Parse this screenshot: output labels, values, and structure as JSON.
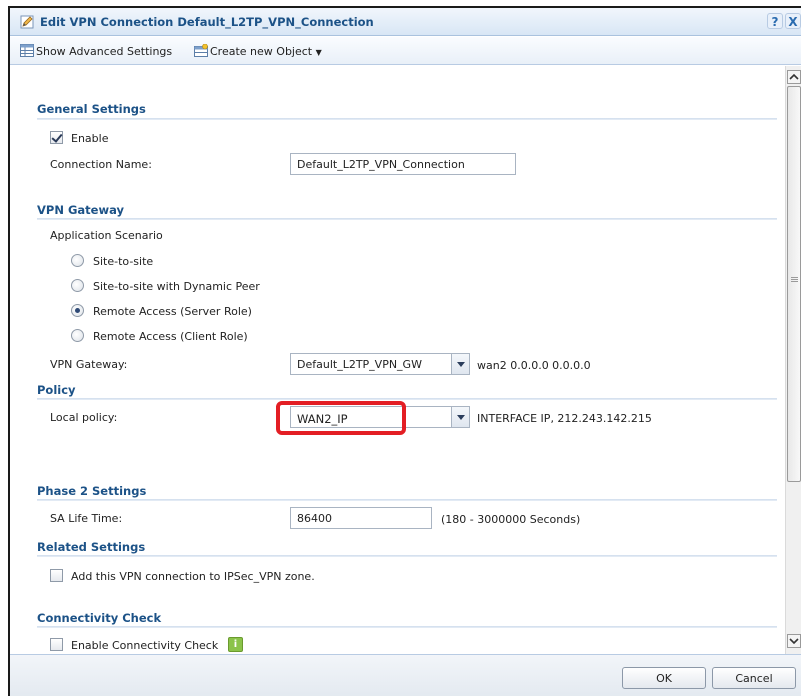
{
  "window": {
    "title": "Edit VPN Connection Default_L2TP_VPN_Connection",
    "help_label": "?",
    "close_label": "X"
  },
  "toolbar": {
    "advanced_label": "Show Advanced Settings",
    "create_label": "Create new Object"
  },
  "general": {
    "title": "General Settings",
    "enable_label": "Enable",
    "enable_checked": true,
    "connection_name_label": "Connection Name:",
    "connection_name_value": "Default_L2TP_VPN_Connection"
  },
  "vpn_gateway": {
    "title": "VPN Gateway",
    "scenario_label": "Application Scenario",
    "scenarios": [
      {
        "label": "Site-to-site",
        "selected": false
      },
      {
        "label": "Site-to-site with Dynamic Peer",
        "selected": false
      },
      {
        "label": "Remote Access (Server Role)",
        "selected": true
      },
      {
        "label": "Remote Access (Client Role)",
        "selected": false
      }
    ],
    "gateway_label": "VPN Gateway:",
    "gateway_value": "Default_L2TP_VPN_GW",
    "gateway_info": "wan2 0.0.0.0 0.0.0.0"
  },
  "policy": {
    "title": "Policy",
    "local_label": "Local policy:",
    "local_value": "WAN2_IP",
    "local_info": "INTERFACE IP, 212.243.142.215"
  },
  "phase2": {
    "title": "Phase 2 Settings",
    "sa_label": "SA Life Time:",
    "sa_value": "86400",
    "sa_range": "(180 - 3000000 Seconds)"
  },
  "related": {
    "title": "Related Settings",
    "zone_label": "Add this VPN connection to IPSec_VPN zone."
  },
  "connectivity": {
    "title": "Connectivity Check",
    "enable_label": "Enable Connectivity Check",
    "info_glyph": "i"
  },
  "footer": {
    "ok_label": "OK",
    "cancel_label": "Cancel"
  },
  "colors": {
    "section_title": "#1c5287",
    "highlight": "#e31e24"
  }
}
